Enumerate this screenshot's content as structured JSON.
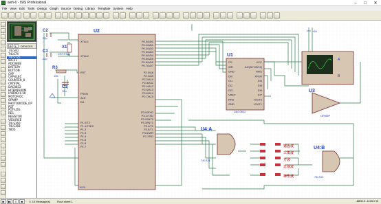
{
  "window": {
    "title": "wxh-6 - ISIS Professional",
    "min_glyph": "–",
    "max_glyph": "□",
    "close_glyph": "✕"
  },
  "menu": [
    "File",
    "View",
    "Edit",
    "Tools",
    "Design",
    "Graph",
    "Source",
    "Debug",
    "Library",
    "Template",
    "System",
    "Help"
  ],
  "devices_panel": {
    "pick_label": "P",
    "lib_label": "L",
    "title": "DEVICES",
    "items": [
      "74LS00",
      "74LS74",
      "74LS125",
      "80C51",
      "ADC0808",
      "BATTERY",
      "BUTTON",
      "CAP",
      "CAP-ELEC",
      "COUNTER_8",
      "CRYSTAL",
      "DAC0832",
      "HITEMP300M",
      "HYBRID 6.5K",
      "MOTOR-DC",
      "OPAMP",
      "PHOTODIODE_OP",
      "POT",
      "POT-LOG",
      "RES",
      "RESISTOR",
      "VSOURCE",
      "74LS160",
      "74LS168",
      "7805"
    ],
    "selected_index": 2
  },
  "schematic": {
    "components": {
      "c2": {
        "ref": "C2",
        "value": "22p"
      },
      "c3": {
        "ref": "C3",
        "value": "22p"
      },
      "x1": {
        "ref": "X1",
        "value": "CRYSTAL"
      },
      "r3": {
        "ref": "R3",
        "value": "10k"
      },
      "c1": {
        "ref": "C1",
        "value": "10u"
      },
      "u2": {
        "ref": "U2",
        "part": "8051"
      },
      "u1": {
        "ref": "U1",
        "part": "DAC0832"
      },
      "u3": {
        "ref": "U3",
        "part": "OPAMP"
      },
      "u4a": {
        "ref": "U4:A",
        "part": "74LS21"
      },
      "u4b": {
        "ref": "U4:B",
        "part": "74LS21"
      },
      "vcc": {
        "label": "+5V"
      },
      "scope": {
        "chA": "A",
        "chB": "B"
      }
    },
    "u2_left_pins": [
      "XTAL1",
      "XTAL2",
      "RST",
      "PSEN",
      "ALE",
      "EA",
      "P1.0/T2",
      "P1.1/T2EX",
      "P1.2",
      "P1.3",
      "P1.4",
      "P1.5",
      "P1.6",
      "P1.7"
    ],
    "u2_right_pins": [
      "P0.0/AD0",
      "P0.1/AD1",
      "P0.2/AD2",
      "P0.3/AD3",
      "P0.4/AD4",
      "P0.5/AD5",
      "P0.6/AD6",
      "P0.7/AD7",
      "P2.0/A8",
      "P2.1/A9",
      "P2.2/A10",
      "P2.3/A11",
      "P2.4/A12",
      "P2.5/A13",
      "P2.6/A14",
      "P2.7/A15",
      "P3.0/RXD",
      "P3.1/TXD",
      "P3.2/INT0",
      "P3.3/INT1",
      "P3.4/T0",
      "P3.5/T1",
      "P3.6/WR",
      "P3.7/RD"
    ],
    "u1_left_pins": [
      "CS",
      "WR",
      "GND",
      "DI0",
      "DI1",
      "DI2",
      "DI3",
      "VREF",
      "RFB",
      "GND"
    ],
    "u1_right_pins": [
      "VCC",
      "ILE(BY1/BY2)",
      "WR2",
      "XFER",
      "DI4",
      "DI5",
      "DI6",
      "DI7",
      "IOUT2",
      "IOUT1"
    ],
    "switch_labels": [
      "锯齿波",
      "三角波",
      "方波",
      "正弦波",
      "梯形波"
    ]
  },
  "status": {
    "messages": "13 Message(s)",
    "root": "Root sheet 1",
    "coords_x": "-8800.0",
    "coords_y": "-1100.0",
    "unit": "th"
  },
  "colors": {
    "wire": "#2a7d4a",
    "component_fill": "#d7c6b2",
    "component_stroke": "#7a2a2a",
    "text_blue": "#1e3cc8",
    "text_red": "#c80000",
    "grid": "#eef2ee",
    "scope_bg": "#1c2e1c",
    "selection": "#316ac5"
  }
}
